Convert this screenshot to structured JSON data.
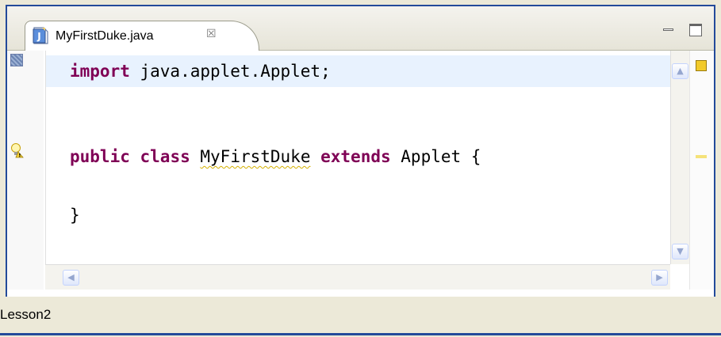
{
  "tab": {
    "label": "MyFirstDuke.java",
    "close_glyph": "☒"
  },
  "code": {
    "line1": {
      "kw": "import",
      "rest": " java.applet.Applet;"
    },
    "line2": {
      "kw_public": "public",
      "kw_class": "class",
      "class_name": "MyFirstDuke",
      "kw_extends": "extends",
      "rest": " Applet {"
    },
    "line3": "}"
  },
  "scrollbars": {
    "up": "▲",
    "down": "▼",
    "left": "◀",
    "right": "▶"
  },
  "status": {
    "text": "Lesson2"
  },
  "colors": {
    "keyword": "#7f0055",
    "current_line": "#e8f2fe",
    "frame": "#234a9a",
    "warning": "#d4b000"
  }
}
